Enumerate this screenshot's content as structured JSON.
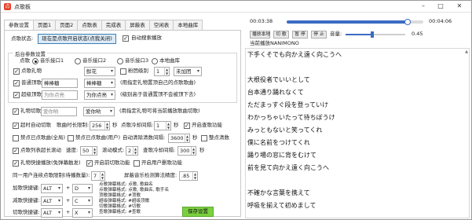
{
  "window": {
    "title": "点歌板",
    "icon_text": "点"
  },
  "tabs": [
    "参数设置",
    "页面1",
    "页面2",
    "点歌表",
    "完成表",
    "屏蔽表",
    "空闲表",
    "本地曲库"
  ],
  "settings": {
    "status_label": "点歌状态:",
    "status_button": "现在是点歌开启状态(点我关闭)",
    "auto_search": {
      "label": "自动搜索播放",
      "checked": true
    },
    "group_title": "后台参数设置",
    "source_label": "点歌",
    "sources": [
      {
        "label": "音乐接口1",
        "selected": true
      },
      {
        "label": "音乐接口2",
        "selected": false
      },
      {
        "label": "音乐接口3",
        "selected": false
      },
      {
        "label": "本地曲库",
        "selected": false
      }
    ],
    "row_gift": {
      "check_label": "点歌礼物",
      "checked": true,
      "gift_value": "鲜花",
      "level_check_label": "粉团级别",
      "level_checked": false,
      "level_value": "1",
      "level_select": "未加团"
    },
    "row_normal": {
      "check_label": "普通顶歌",
      "checked": true,
      "input_value": "棒棒糖",
      "select_value": "棒棒糖",
      "note": "(用指定礼物置顶自己的点歌歌曲)"
    },
    "row_super": {
      "check_label": "超级顶歌",
      "checked": true,
      "input_value": "为你点亮",
      "select_value": "为你点亮",
      "note": "(级别高于普通置顶不会被顶下去)"
    },
    "row_cut": {
      "check_label": "礼物切歌",
      "checked": true,
      "input_value": "爱你哟",
      "select_value": "爱你哟",
      "note": "(用指定礼物可将当前播放歌曲切歌)"
    },
    "timed_cut": {
      "label": "超时自动切歌",
      "checked": true,
      "duration_label": "歌曲时长限制:",
      "duration_value": "256",
      "unit": "秒",
      "cooldown_label": "点歌冷却间隔:",
      "cooldown_value": "1",
      "cooldown_unit": "秒",
      "open_fans_label": "开启查歌功能",
      "open_fans_checked": true
    },
    "limits": {
      "check1_label": "禁点已点歌曲(全局)",
      "check1_checked": false,
      "check2_label": "禁点已点歌曲(用户)",
      "check2_checked": false,
      "clear_label": "自动清除",
      "clear_interval_label": "清数间隔:",
      "clear_value": "3600",
      "unit": "秒",
      "reset_label": "整点清数",
      "reset_checked": false
    },
    "scroll_row": {
      "check_label": "点歌列表超长滚动",
      "checked": true,
      "speed_label": "速度:",
      "speed_value": "50",
      "rows_label": "滚动模式:",
      "rows_value": "2",
      "cooldown_label": "查歌冷却间隔:",
      "cooldown_value": "300",
      "unit": "秒"
    },
    "hotkey_row": {
      "check_label": "礼物快捷播放(免弹幕触发)",
      "checked": true,
      "fans_label": "开启前切歌功能",
      "fans_checked": true,
      "user_label": "开启用户删歌功能",
      "user_checked": false
    },
    "user_limit": {
      "label": "同一用户连续点歌限制(待播数量):",
      "value": "7",
      "similarity_label": "屏蔽音乐检测算法精度:",
      "similarity_value": ".85"
    },
    "shortcuts": [
      {
        "label": "加歌快捷键:",
        "mod": "ALT",
        "plus": "+",
        "key": "D"
      },
      {
        "label": "减歌快捷键:",
        "mod": "ALT",
        "plus": "+",
        "key": "C"
      },
      {
        "label": "切歌快捷键:",
        "mod": "ALT",
        "plus": "+",
        "key": "X"
      }
    ],
    "formats": [
      "点歌弹幕格式: 点歌, 歌曲名",
      "点歌弹幕格式: 点歌, 歌曲名, 歌手名",
      "顶歌弹幕格式: #顶歌",
      "超级弹幕格式: #超级顶歌",
      "切歌弹幕格式: #切歌",
      "查歌弹幕格式: #查歌"
    ],
    "save_button": "保存设置"
  },
  "player": {
    "current_time": "00:03:38",
    "total_time": "00:04:06",
    "progress": 0.886,
    "buttons": [
      "播放本地",
      "切 歌",
      "暂 停",
      "停 止"
    ],
    "volume_label": "音量:",
    "volume_value": "0.45",
    "volume": 0.45,
    "now_playing": "当前播放NANIMONO"
  },
  "lyrics": [
    "下手くそでも向かえ遠く向こうへ",
    "",
    "大根役者でいいとして",
    "台本通り踊れなくて",
    "ただまっすぐ段を登っていけ",
    "わかっちゃいたって待ちぼうけ",
    "みっともないと笑ってくれ",
    "僕に名前をつけてくれ",
    "踊り場の窓に背をむけて",
    "前を見て向かえ遠く向こうへ",
    "",
    "不確かな言葉を携えて",
    "呼吸を揃えて初めまして"
  ]
}
